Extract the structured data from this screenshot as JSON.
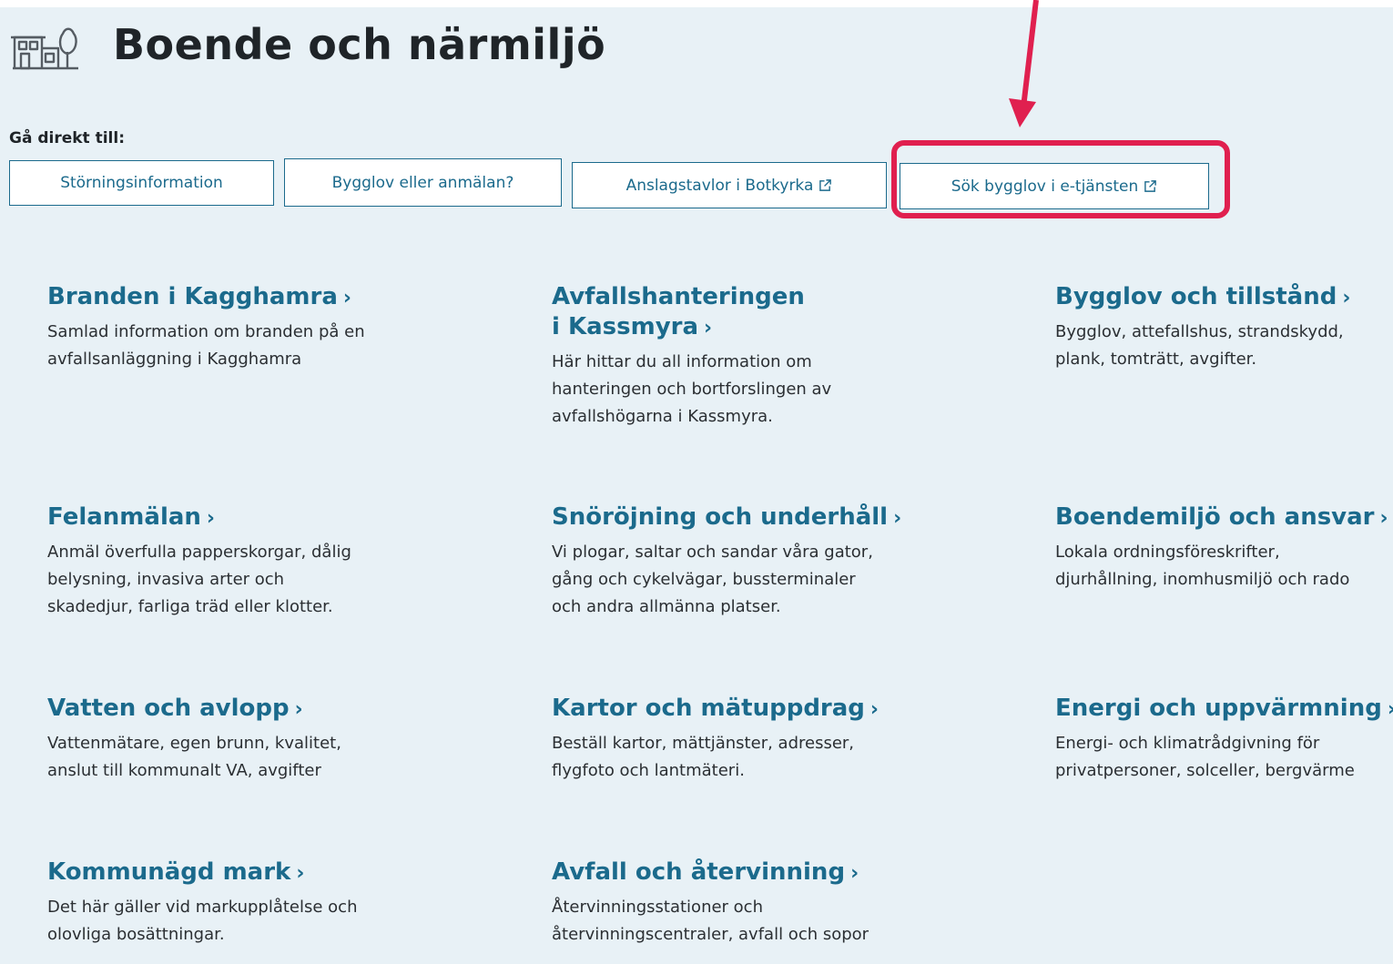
{
  "page": {
    "title": "Boende och närmiljö",
    "icon": "house-tree-icon"
  },
  "goto": {
    "label": "Gå direkt till:",
    "links": [
      {
        "label": "Störningsinformation",
        "external": false
      },
      {
        "label": "Bygglov eller anmälan?",
        "external": false
      },
      {
        "label": "Anslagstavlor i Botkyrka",
        "external": true
      },
      {
        "label": "Sök bygglov i e-tjänsten",
        "external": true
      }
    ]
  },
  "annotation": {
    "color": "#e0204f",
    "highlighted_link": "Sök bygglov i e-tjänsten"
  },
  "chevron": "›",
  "cards": [
    {
      "title": "Branden i Kagghamra",
      "desc": "Samlad information om branden på en\navfallsanläggning i Kagghamra"
    },
    {
      "title": "Avfallshanteringen\ni Kassmyra",
      "desc": "Här hittar du all information om\nhanteringen och bortforslingen av\navfallshögarna i Kassmyra."
    },
    {
      "title": "Bygglov och tillstånd",
      "desc": "Bygglov, attefallshus, strandskydd,\nplank, tomträtt, avgifter."
    },
    {
      "title": "Felanmälan",
      "desc": "Anmäl överfulla papperskorgar, dålig\nbelysning, invasiva arter och\nskadedjur, farliga träd eller klotter."
    },
    {
      "title": "Snöröjning och underhåll",
      "desc": "Vi plogar, saltar och sandar våra gator,\ngång och cykelvägar, bussterminaler\noch andra allmänna platser."
    },
    {
      "title": "Boendemiljö och ansvar",
      "desc": "Lokala ordningsföreskrifter,\ndjurhållning, inomhusmiljö och rado"
    },
    {
      "title": "Vatten och avlopp",
      "desc": "Vattenmätare, egen brunn, kvalitet,\nanslut till kommunalt VA, avgifter"
    },
    {
      "title": "Kartor och mätuppdrag",
      "desc": "Beställ kartor, mättjänster, adresser,\nflygfoto och lantmäteri."
    },
    {
      "title": "Energi och uppvärmning",
      "desc": "Energi- och klimatrådgivning för\nprivatpersoner, solceller, bergvärme"
    },
    {
      "title": "Kommunägd mark",
      "desc": "Det här gäller vid markupplåtelse och\nolovliga bosättningar."
    },
    {
      "title": "Avfall och återvinning",
      "desc": "Återvinningsstationer och\nåtervinningscentraler, avfall och sopor"
    }
  ],
  "colors": {
    "background": "#e8f1f6",
    "link": "#1b6a8c",
    "text": "#2b2f33",
    "heading": "#1f2428"
  }
}
